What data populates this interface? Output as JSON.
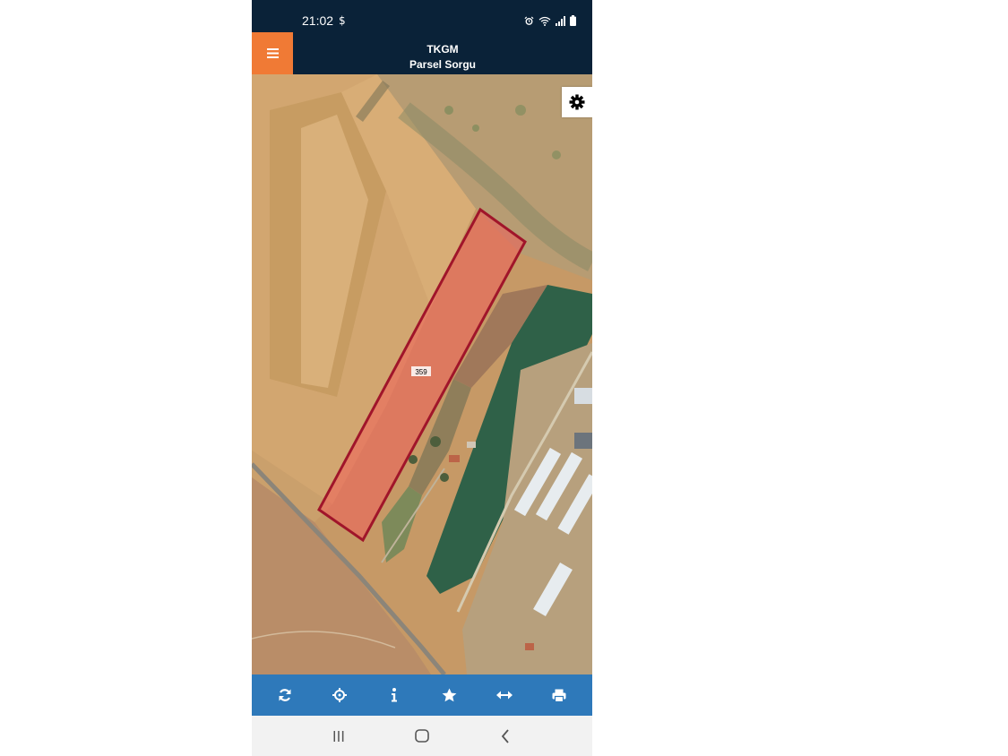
{
  "status_bar": {
    "time": "21:02",
    "extra_symbol": "$",
    "icons": [
      "alarm-icon",
      "wifi-icon",
      "signal-icon",
      "battery-icon"
    ]
  },
  "app_bar": {
    "title": "TKGM",
    "subtitle": "Parsel Sorgu",
    "menu_icon": "hamburger-menu-icon",
    "accent_color": "#f07a35",
    "bar_color": "#0a2238"
  },
  "map": {
    "parcel_label": "359",
    "parcel_color": "#a0152a",
    "settings_icon": "gear-icon"
  },
  "toolbar": {
    "color": "#2e79ba",
    "items": [
      "refresh-icon",
      "locate-crosshair-icon",
      "info-icon",
      "star-icon",
      "measure-arrows-icon",
      "print-icon"
    ]
  },
  "system_nav": {
    "items": [
      "recent-apps-icon",
      "home-icon",
      "back-icon"
    ]
  }
}
